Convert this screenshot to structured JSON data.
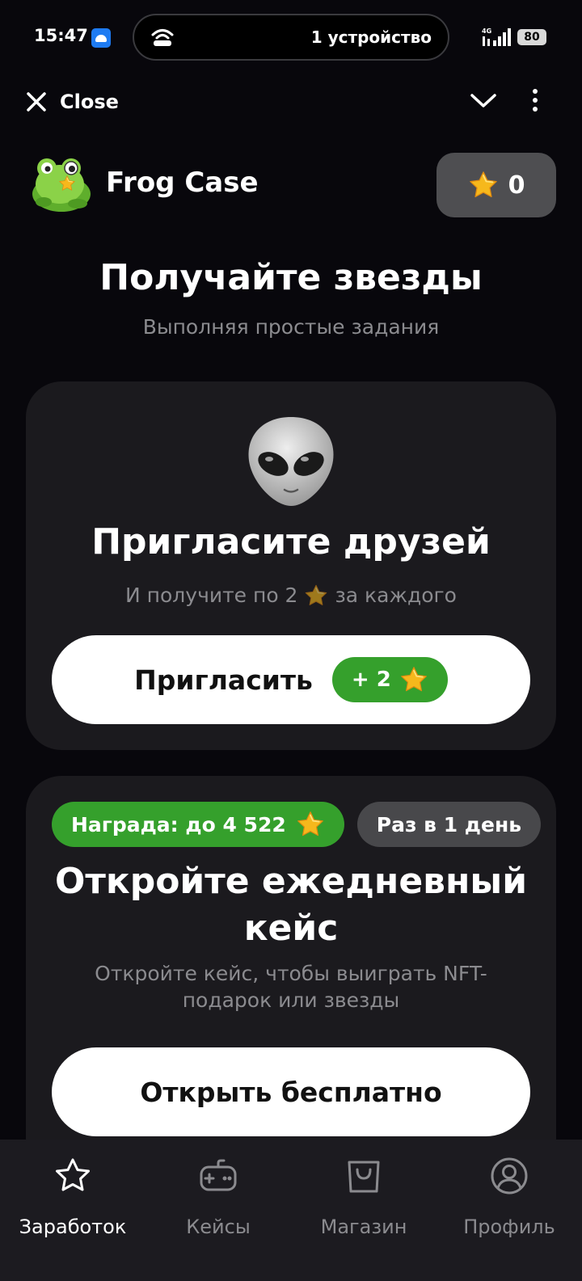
{
  "status_bar": {
    "time": "15:47",
    "island_text": "1 устройство",
    "battery": "80"
  },
  "header": {
    "close_label": "Close"
  },
  "brand": {
    "name": "Frog Case",
    "balance": "0"
  },
  "hero": {
    "title": "Получайте звезды",
    "subtitle": "Выполняя простые задания"
  },
  "invite_card": {
    "title": "Пригласите друзей",
    "desc_before": "И получите по 2",
    "desc_after": "за каждого",
    "button_label": "Пригласить",
    "button_reward": "+ 2"
  },
  "daily_card": {
    "reward_badge": "Награда: до 4 522",
    "frequency_badge": "Раз в 1 день",
    "title": "Откройте ежедневный кейс",
    "desc": "Откройте кейс, чтобы выиграть NFT-подарок или звезды",
    "button_label": "Открыть бесплатно"
  },
  "bottom_nav": {
    "items": [
      {
        "label": "Заработок",
        "icon": "star-outline-icon",
        "active": true
      },
      {
        "label": "Кейсы",
        "icon": "gamepad-icon",
        "active": false
      },
      {
        "label": "Магазин",
        "icon": "shopping-bag-icon",
        "active": false
      },
      {
        "label": "Профиль",
        "icon": "profile-icon",
        "active": false
      }
    ]
  },
  "colors": {
    "background": "#08070c",
    "card": "#1b1a1e",
    "accent_green": "#35a02c",
    "star": "#f6b81c",
    "muted_text": "#8b8b8f"
  }
}
